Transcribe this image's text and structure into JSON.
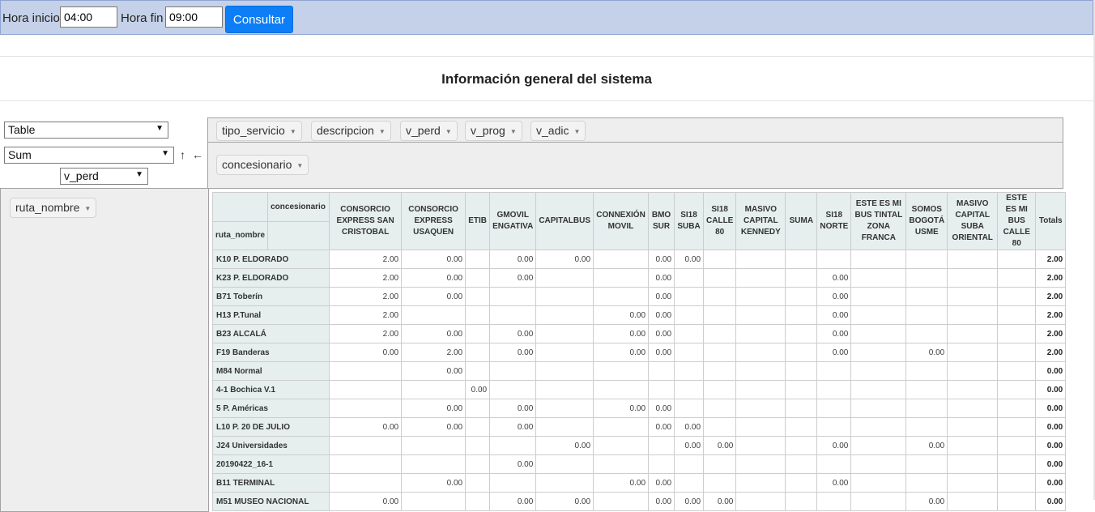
{
  "topbar": {
    "start_label": "Hora inicio",
    "start_value": "04:00",
    "end_label": "Hora fin",
    "end_value": "09:00",
    "button_label": "Consultar"
  },
  "title": "Información general del sistema",
  "pivot": {
    "renderer": "Table",
    "aggregator": "Sum",
    "sort_icon": "↑",
    "order_icon": "←",
    "value_field": "v_perd",
    "unused_fields": [
      "tipo_servicio",
      "descripcion",
      "v_perd",
      "v_prog",
      "v_adic"
    ],
    "col_fields": [
      "concesionario"
    ],
    "row_fields": [
      "ruta_nombre"
    ]
  },
  "table": {
    "col_attr": "concesionario",
    "row_attr": "ruta_nombre",
    "columns": [
      "CONSORCIO EXPRESS SAN CRISTOBAL",
      "CONSORCIO EXPRESS USAQUEN",
      "ETIB",
      "GMOVIL ENGATIVA",
      "CAPITALBUS",
      "CONNEXIÓN MOVIL",
      "BMO SUR",
      "SI18 SUBA",
      "SI18 CALLE 80",
      "MASIVO CAPITAL KENNEDY",
      "SUMA",
      "SI18 NORTE",
      "ESTE ES MI BUS TINTAL ZONA FRANCA",
      "SOMOS BOGOTÁ USME",
      "MASIVO CAPITAL SUBA ORIENTAL",
      "ESTE ES MI BUS CALLE 80"
    ],
    "totals_label": "Totals",
    "rows": [
      {
        "label": "K10 P. ELDORADO",
        "cells": [
          "2.00",
          "0.00",
          "",
          "0.00",
          "0.00",
          "",
          "0.00",
          "0.00",
          "",
          "",
          "",
          "",
          "",
          "",
          "",
          ""
        ],
        "total": "2.00"
      },
      {
        "label": "K23 P. ELDORADO",
        "cells": [
          "2.00",
          "0.00",
          "",
          "0.00",
          "",
          "",
          "0.00",
          "",
          "",
          "",
          "",
          "0.00",
          "",
          "",
          "",
          ""
        ],
        "total": "2.00"
      },
      {
        "label": "B71 Toberín",
        "cells": [
          "2.00",
          "0.00",
          "",
          "",
          "",
          "",
          "0.00",
          "",
          "",
          "",
          "",
          "0.00",
          "",
          "",
          "",
          ""
        ],
        "total": "2.00"
      },
      {
        "label": "H13 P.Tunal",
        "cells": [
          "2.00",
          "",
          "",
          "",
          "",
          "0.00",
          "0.00",
          "",
          "",
          "",
          "",
          "0.00",
          "",
          "",
          "",
          ""
        ],
        "total": "2.00"
      },
      {
        "label": "B23 ALCALÁ",
        "cells": [
          "2.00",
          "0.00",
          "",
          "0.00",
          "",
          "0.00",
          "0.00",
          "",
          "",
          "",
          "",
          "0.00",
          "",
          "",
          "",
          ""
        ],
        "total": "2.00"
      },
      {
        "label": "F19 Banderas",
        "cells": [
          "0.00",
          "2.00",
          "",
          "0.00",
          "",
          "0.00",
          "0.00",
          "",
          "",
          "",
          "",
          "0.00",
          "",
          "0.00",
          "",
          ""
        ],
        "total": "2.00"
      },
      {
        "label": "M84 Normal",
        "cells": [
          "",
          "0.00",
          "",
          "",
          "",
          "",
          "",
          "",
          "",
          "",
          "",
          "",
          "",
          "",
          "",
          ""
        ],
        "total": "0.00"
      },
      {
        "label": "4-1 Bochica V.1",
        "cells": [
          "",
          "",
          "0.00",
          "",
          "",
          "",
          "",
          "",
          "",
          "",
          "",
          "",
          "",
          "",
          "",
          ""
        ],
        "total": "0.00"
      },
      {
        "label": "5 P. Américas",
        "cells": [
          "",
          "0.00",
          "",
          "0.00",
          "",
          "0.00",
          "0.00",
          "",
          "",
          "",
          "",
          "",
          "",
          "",
          "",
          ""
        ],
        "total": "0.00"
      },
      {
        "label": "L10 P. 20 DE JULIO",
        "cells": [
          "0.00",
          "0.00",
          "",
          "0.00",
          "",
          "",
          "0.00",
          "0.00",
          "",
          "",
          "",
          "",
          "",
          "",
          "",
          ""
        ],
        "total": "0.00"
      },
      {
        "label": "J24 Universidades",
        "cells": [
          "",
          "",
          "",
          "",
          "0.00",
          "",
          "",
          "0.00",
          "0.00",
          "",
          "",
          "0.00",
          "",
          "0.00",
          "",
          ""
        ],
        "total": "0.00"
      },
      {
        "label": "20190422_16-1",
        "cells": [
          "",
          "",
          "",
          "0.00",
          "",
          "",
          "",
          "",
          "",
          "",
          "",
          "",
          "",
          "",
          "",
          ""
        ],
        "total": "0.00"
      },
      {
        "label": "B11 TERMINAL",
        "cells": [
          "",
          "0.00",
          "",
          "",
          "",
          "0.00",
          "0.00",
          "",
          "",
          "",
          "",
          "0.00",
          "",
          "",
          "",
          ""
        ],
        "total": "0.00"
      },
      {
        "label": "M51 MUSEO NACIONAL",
        "cells": [
          "0.00",
          "",
          "",
          "0.00",
          "0.00",
          "",
          "0.00",
          "0.00",
          "0.00",
          "",
          "",
          "",
          "",
          "0.00",
          "",
          ""
        ],
        "total": "0.00"
      }
    ]
  }
}
